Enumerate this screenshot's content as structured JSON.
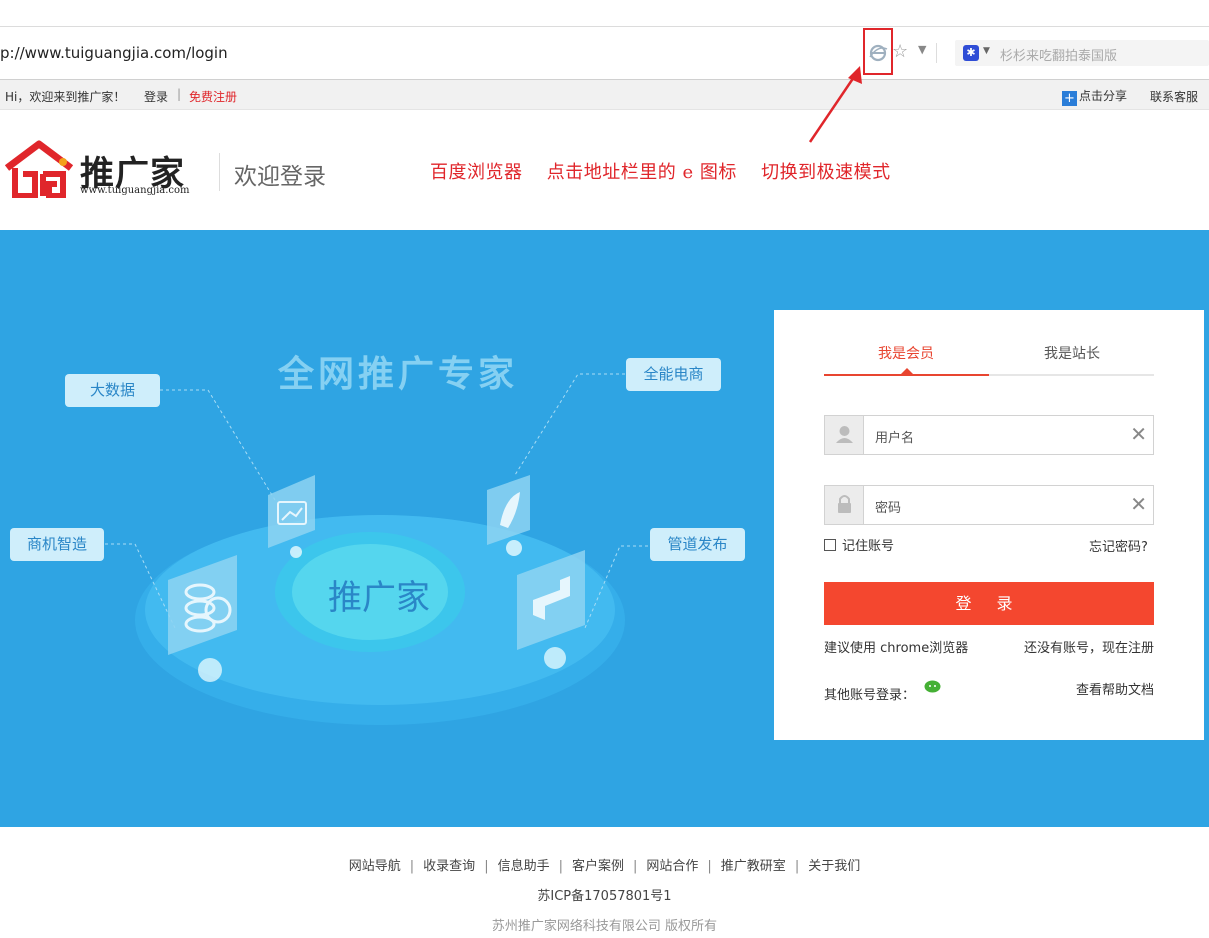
{
  "browser": {
    "url": "p://www.tuiguangjia.com/login",
    "search_placeholder": "杉杉来吃翻拍泰国版"
  },
  "sitebar": {
    "greeting": "Hi，欢迎来到推广家！",
    "login": "登录",
    "separator": "|",
    "register": "免费注册",
    "share": "点击分享",
    "service": "联系客服"
  },
  "header": {
    "logo_text": "推广家",
    "logo_url": "www.tuiguangjia.com",
    "welcome": "欢迎登录",
    "tip": [
      "百度浏览器",
      "点击地址栏里的 e 图标",
      "切换到极速模式"
    ]
  },
  "banner": {
    "slogan": "全网推广专家",
    "center_label": "推广家",
    "bubbles": {
      "big_data": "大数据",
      "ecommerce": "全能电商",
      "smart_manufacturing": "商机智造",
      "channel_publish": "管道发布"
    }
  },
  "login": {
    "tab_member": "我是会员",
    "tab_owner": "我是站长",
    "username_placeholder": "用户名",
    "password_placeholder": "密码",
    "remember": "记住账号",
    "forgot": "忘记密码?",
    "submit": "登 录",
    "suggest": "建议使用 chrome浏览器",
    "no_account": "还没有账号，现在注册",
    "other_login": "其他账号登录：",
    "help": "查看帮助文档"
  },
  "footer": {
    "nav": [
      "网站导航",
      "收录查询",
      "信息助手",
      "客户案例",
      "网站合作",
      "推广教研室",
      "关于我们"
    ],
    "icp": "苏ICP备17057801号1",
    "copyright": "苏州推广家网络科技有限公司 版权所有"
  },
  "colors": {
    "accent_red": "#e0262b",
    "banner_blue": "#2fa4e3",
    "button_red": "#f4472f"
  }
}
